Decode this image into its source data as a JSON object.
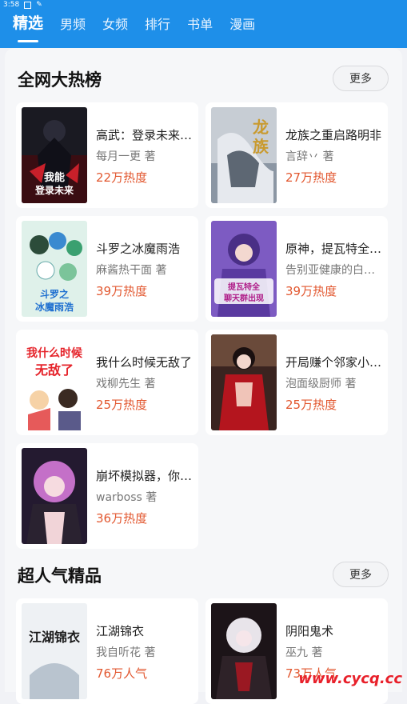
{
  "status": {
    "time": "3:58"
  },
  "tabs": [
    {
      "label": "精选",
      "active": true
    },
    {
      "label": "男频"
    },
    {
      "label": "女频"
    },
    {
      "label": "排行"
    },
    {
      "label": "书单"
    },
    {
      "label": "漫画"
    }
  ],
  "sections": [
    {
      "title": "全网大热榜",
      "more": "更多",
      "books": [
        {
          "title": "高武：登录未来…",
          "author": "每月一更",
          "author_suffix": "著",
          "heat": "22万热度",
          "cover_theme": "dark-anime",
          "cover_text": "高武 我能登录未来"
        },
        {
          "title": "龙族之重启路明非",
          "author": "言辞丷",
          "author_suffix": "著",
          "heat": "27万热度",
          "cover_theme": "pale-dragon",
          "cover_text": "龙族"
        },
        {
          "title": "斗罗之冰魔雨浩",
          "author": "麻酱热干面",
          "author_suffix": "著",
          "heat": "39万热度",
          "cover_theme": "ice-green",
          "cover_text": "斗罗之 冰魔雨浩"
        },
        {
          "title": "原神，提瓦特全…",
          "author": "告别亚健康的白…",
          "author_suffix": "",
          "heat": "39万热度",
          "cover_theme": "purple-raiden",
          "cover_text": "提瓦特全 聊天群出现"
        },
        {
          "title": "我什么时候无敌了",
          "author": "戏柳先生",
          "author_suffix": "著",
          "heat": "25万热度",
          "cover_theme": "red-cartoon",
          "cover_text": "我什么时候 无敌了"
        },
        {
          "title": "开局赚个邻家小…",
          "author": "泡面级厨师",
          "author_suffix": "著",
          "heat": "25万热度",
          "cover_theme": "kimono-red",
          "cover_text": ""
        },
        {
          "title": "崩坏模拟器，你…",
          "author": "warboss",
          "author_suffix": "著",
          "heat": "36万热度",
          "cover_theme": "pink-hair",
          "cover_text": ""
        }
      ]
    },
    {
      "title": "超人气精品",
      "more": "更多",
      "books": [
        {
          "title": "江湖锦衣",
          "author": "我自听花",
          "author_suffix": "著",
          "heat": "76万人气",
          "cover_theme": "ink-white",
          "cover_text": "江湖锦衣"
        },
        {
          "title": "阴阳鬼术",
          "author": "巫九",
          "author_suffix": "著",
          "heat": "73万人气",
          "cover_theme": "gothic-dark",
          "cover_text": ""
        }
      ]
    }
  ],
  "watermark": "www.cycq.cc",
  "colors": {
    "brand": "#1e8fe9",
    "heat": "#e2572f"
  }
}
